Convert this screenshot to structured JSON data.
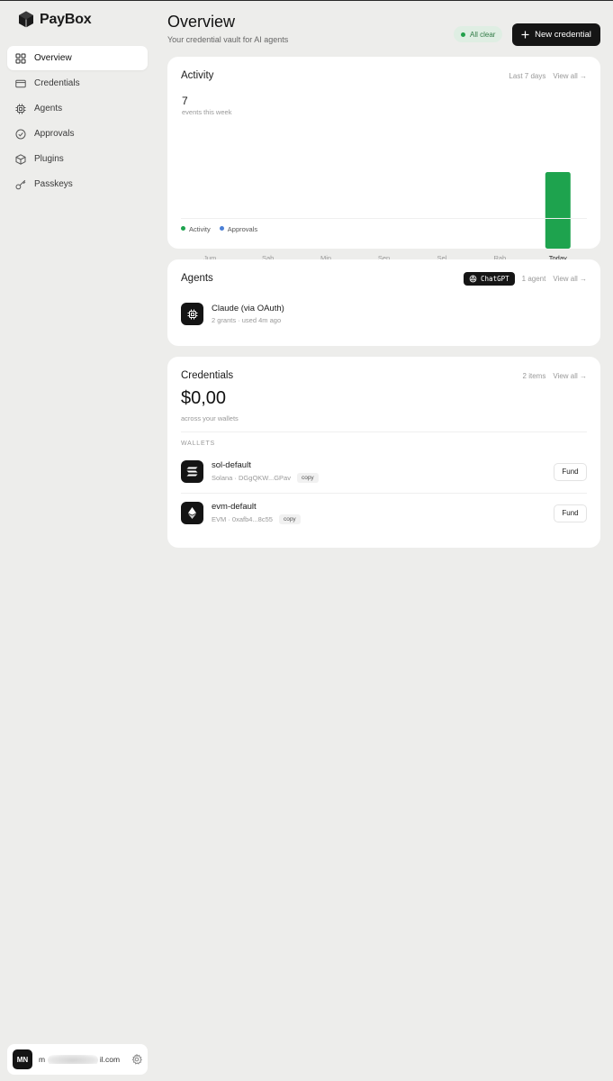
{
  "brand": {
    "name": "PayBox"
  },
  "sidebar": {
    "items": [
      {
        "label": "Overview",
        "icon": "grid-icon",
        "active": true
      },
      {
        "label": "Credentials",
        "icon": "card-icon",
        "active": false
      },
      {
        "label": "Agents",
        "icon": "chip-icon",
        "active": false
      },
      {
        "label": "Approvals",
        "icon": "check-circle-icon",
        "active": false
      },
      {
        "label": "Plugins",
        "icon": "cube-icon",
        "active": false
      },
      {
        "label": "Passkeys",
        "icon": "key-icon",
        "active": false
      }
    ]
  },
  "user": {
    "initials": "MN",
    "email_prefix": "m",
    "email_suffix": "il.com"
  },
  "header": {
    "title": "Overview",
    "subtitle": "Your credential vault for AI agents",
    "status": "All clear",
    "new_button": "New credential"
  },
  "activity": {
    "title": "Activity",
    "range": "Last 7 days",
    "view_all": "View all →",
    "count": "7",
    "count_label": "events this week",
    "legend": [
      {
        "label": "Activity",
        "color": "#1ea34e"
      },
      {
        "label": "Approvals",
        "color": "#4a7fd6"
      }
    ]
  },
  "chart_data": {
    "type": "bar",
    "categories": [
      "Jum",
      "Sab",
      "Min",
      "Sen",
      "Sel",
      "Rab",
      "Today"
    ],
    "series": [
      {
        "name": "Activity",
        "values": [
          0,
          0,
          0,
          0,
          0,
          0,
          7
        ]
      },
      {
        "name": "Approvals",
        "values": [
          0,
          0,
          0,
          0,
          0,
          0,
          0
        ]
      }
    ],
    "ylim": [
      0,
      7
    ],
    "grid": false,
    "legend": "bottom-left",
    "colors": {
      "activity": "#1ea34e",
      "approvals": "#4a7fd6"
    }
  },
  "agents": {
    "title": "Agents",
    "chip": "ChatGPT",
    "count": "1 agent",
    "view_all": "View all →",
    "items": [
      {
        "name": "Claude (via OAuth)",
        "sub": "2 grants · used 4m ago"
      }
    ]
  },
  "credentials": {
    "title": "Credentials",
    "count": "2 items",
    "view_all": "View all →",
    "balance": "$0,00",
    "balance_label": "across your wallets",
    "section": "WALLETS",
    "copy_label": "copy",
    "fund_label": "Fund",
    "wallets": [
      {
        "name": "sol-default",
        "sub": "Solana · DGgQKW...GPav",
        "icon": "solana-icon"
      },
      {
        "name": "evm-default",
        "sub": "EVM · 0xafb4...8c55",
        "icon": "ethereum-icon"
      }
    ]
  }
}
